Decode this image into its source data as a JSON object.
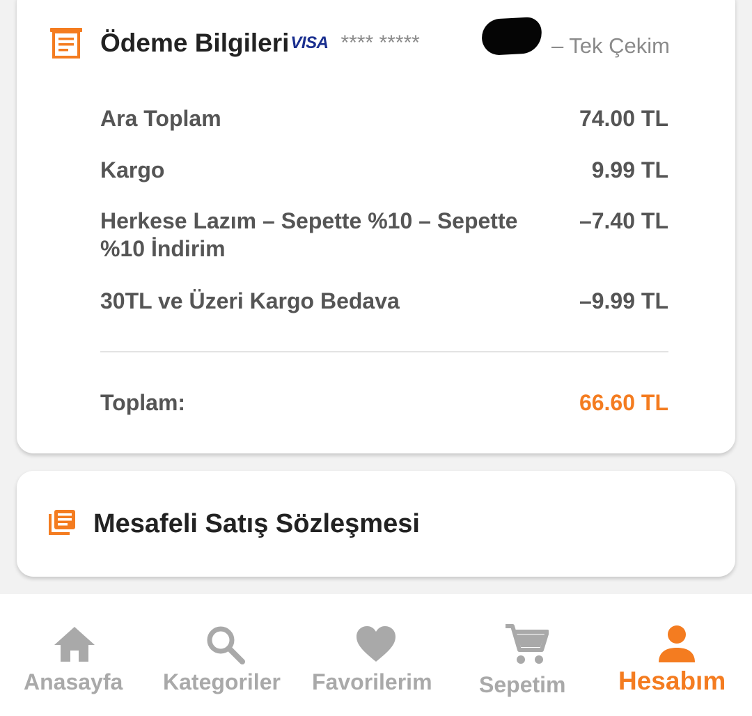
{
  "payment": {
    "title": "Ödeme Bilgileri",
    "card_brand": "VISA",
    "card_mask": "**** *****",
    "installment": "– Tek Çekim",
    "rows": [
      {
        "label": "Ara Toplam",
        "value": "74.00 TL"
      },
      {
        "label": "Kargo",
        "value": "9.99 TL"
      },
      {
        "label": "Herkese Lazım – Sepette %10 – Sepette %10 İndirim",
        "value": "–7.40 TL"
      },
      {
        "label": "30TL ve Üzeri Kargo Bedava",
        "value": "–9.99 TL"
      }
    ],
    "total_label": "Toplam:",
    "total_value": "66.60 TL",
    "icon": "receipt-icon"
  },
  "contract": {
    "title": "Mesafeli Satış Sözleşmesi",
    "icon": "document-list-icon"
  },
  "bottom_nav": {
    "items": [
      {
        "label": "Anasayfa",
        "icon": "home-icon",
        "active": false
      },
      {
        "label": "Kategoriler",
        "icon": "search-icon",
        "active": false
      },
      {
        "label": "Favorilerim",
        "icon": "heart-icon",
        "active": false
      },
      {
        "label": "Sepetim",
        "icon": "cart-icon",
        "active": false
      },
      {
        "label": "Hesabım",
        "icon": "person-icon",
        "active": true
      }
    ]
  },
  "colors": {
    "accent": "#f47c20",
    "inactive": "#a9a9a9",
    "text_dark": "#222222",
    "text_body": "#555555",
    "visa_blue": "#1a2f8f",
    "background": "#f2f2f2"
  }
}
